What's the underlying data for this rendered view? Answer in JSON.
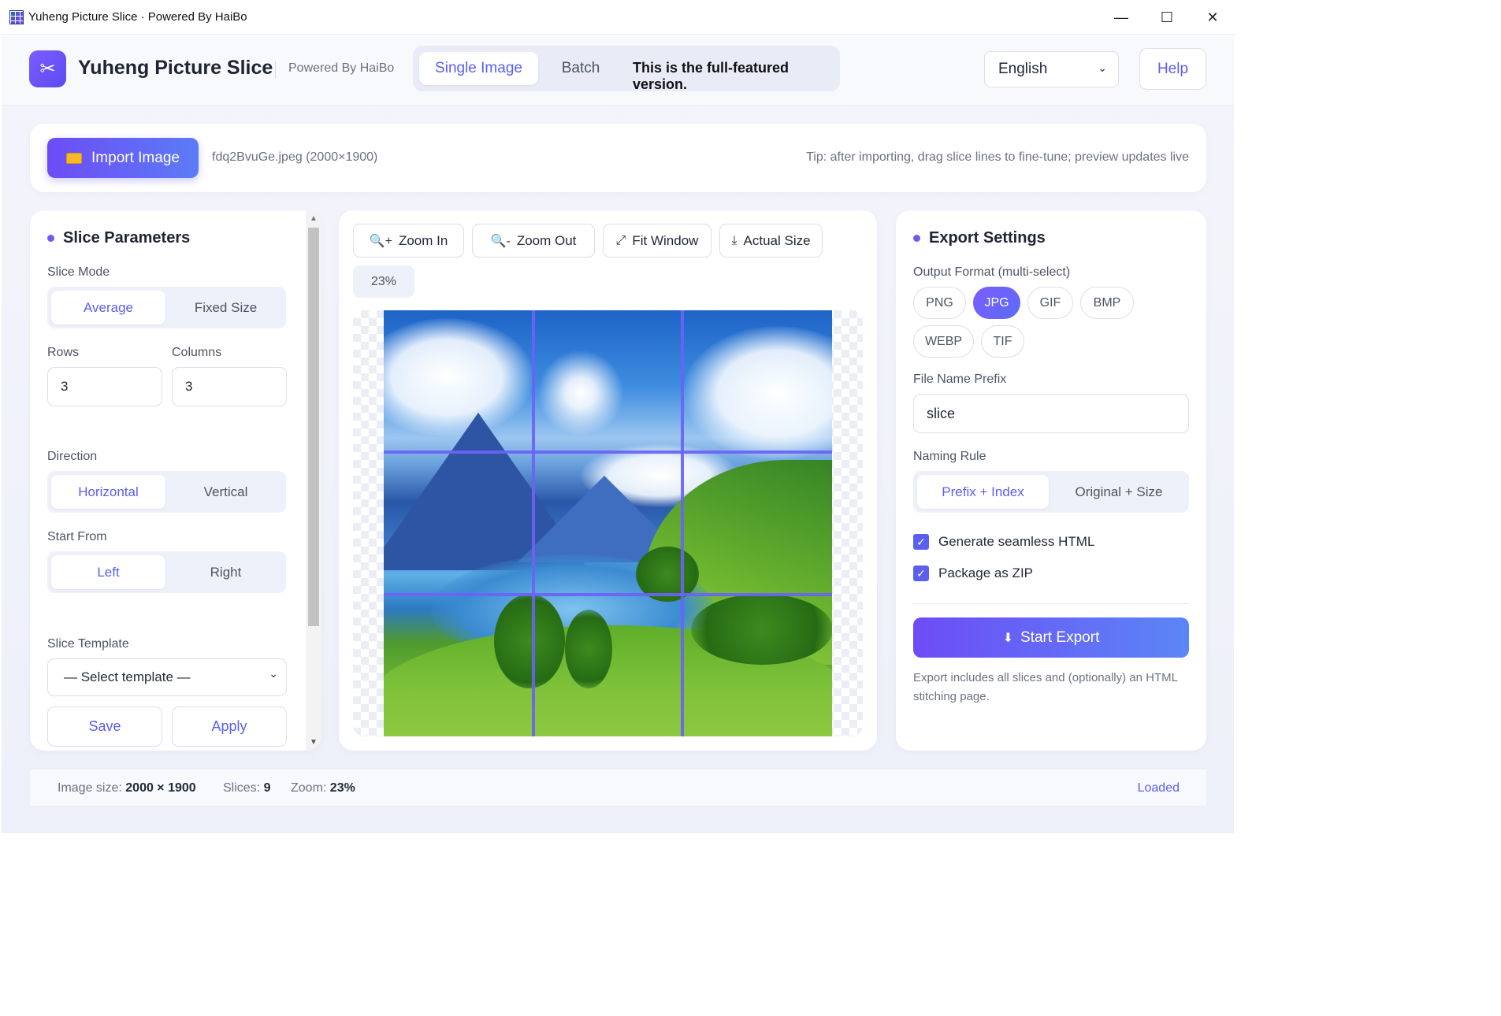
{
  "window": {
    "title": "Yuheng Picture Slice · Powered By HaiBo",
    "minimize": "—",
    "maximize": "☐",
    "close": "✕"
  },
  "header": {
    "app_name": "Yuheng Picture Slice",
    "powered_by": "Powered By HaiBo",
    "tabs": [
      "Single Image",
      "Batch"
    ],
    "active_tab": "Single Image",
    "version_note": "This is the full-featured version.",
    "language": "English",
    "help": "Help"
  },
  "import": {
    "button": "Import Image",
    "file": "fdq2BvuGe.jpeg (2000×1900)",
    "tip": "Tip: after importing, drag slice lines to fine-tune; preview updates live"
  },
  "slice": {
    "title": "Slice Parameters",
    "mode_label": "Slice Mode",
    "modes": [
      "Average",
      "Fixed Size"
    ],
    "active_mode": "Average",
    "rows_label": "Rows",
    "rows": "3",
    "cols_label": "Columns",
    "cols": "3",
    "direction_label": "Direction",
    "directions": [
      "Horizontal",
      "Vertical"
    ],
    "active_direction": "Horizontal",
    "start_label": "Start From",
    "starts": [
      "Left",
      "Right"
    ],
    "active_start": "Left",
    "template_label": "Slice Template",
    "template_value": "— Select template —",
    "save": "Save",
    "apply": "Apply"
  },
  "preview": {
    "zoom_in": "Zoom In",
    "zoom_out": "Zoom Out",
    "fit": "Fit Window",
    "actual": "Actual Size",
    "zoom": "23%",
    "grid_rows": 3,
    "grid_cols": 3
  },
  "export": {
    "title": "Export Settings",
    "format_label": "Output Format (multi-select)",
    "formats": [
      "PNG",
      "JPG",
      "GIF",
      "BMP",
      "WEBP",
      "TIF"
    ],
    "selected_formats": [
      "JPG"
    ],
    "prefix_label": "File Name Prefix",
    "prefix": "slice",
    "naming_label": "Naming Rule",
    "naming": [
      "Prefix + Index",
      "Original + Size"
    ],
    "active_naming": "Prefix + Index",
    "seamless_html": "Generate seamless HTML",
    "seamless_checked": true,
    "zip": "Package as ZIP",
    "zip_checked": true,
    "start": "Start Export",
    "note": "Export includes all slices and (optionally) an HTML stitching page."
  },
  "status": {
    "size_label": "Image size:",
    "size": "2000 × 1900",
    "slices_label": "Slices:",
    "slices": "9",
    "zoom_label": "Zoom:",
    "zoom": "23%",
    "state": "Loaded"
  },
  "colors": {
    "accent": "#5b5ff0",
    "accent_gradient_start": "#6d4cf6",
    "slice_line": "#6b63f5"
  }
}
